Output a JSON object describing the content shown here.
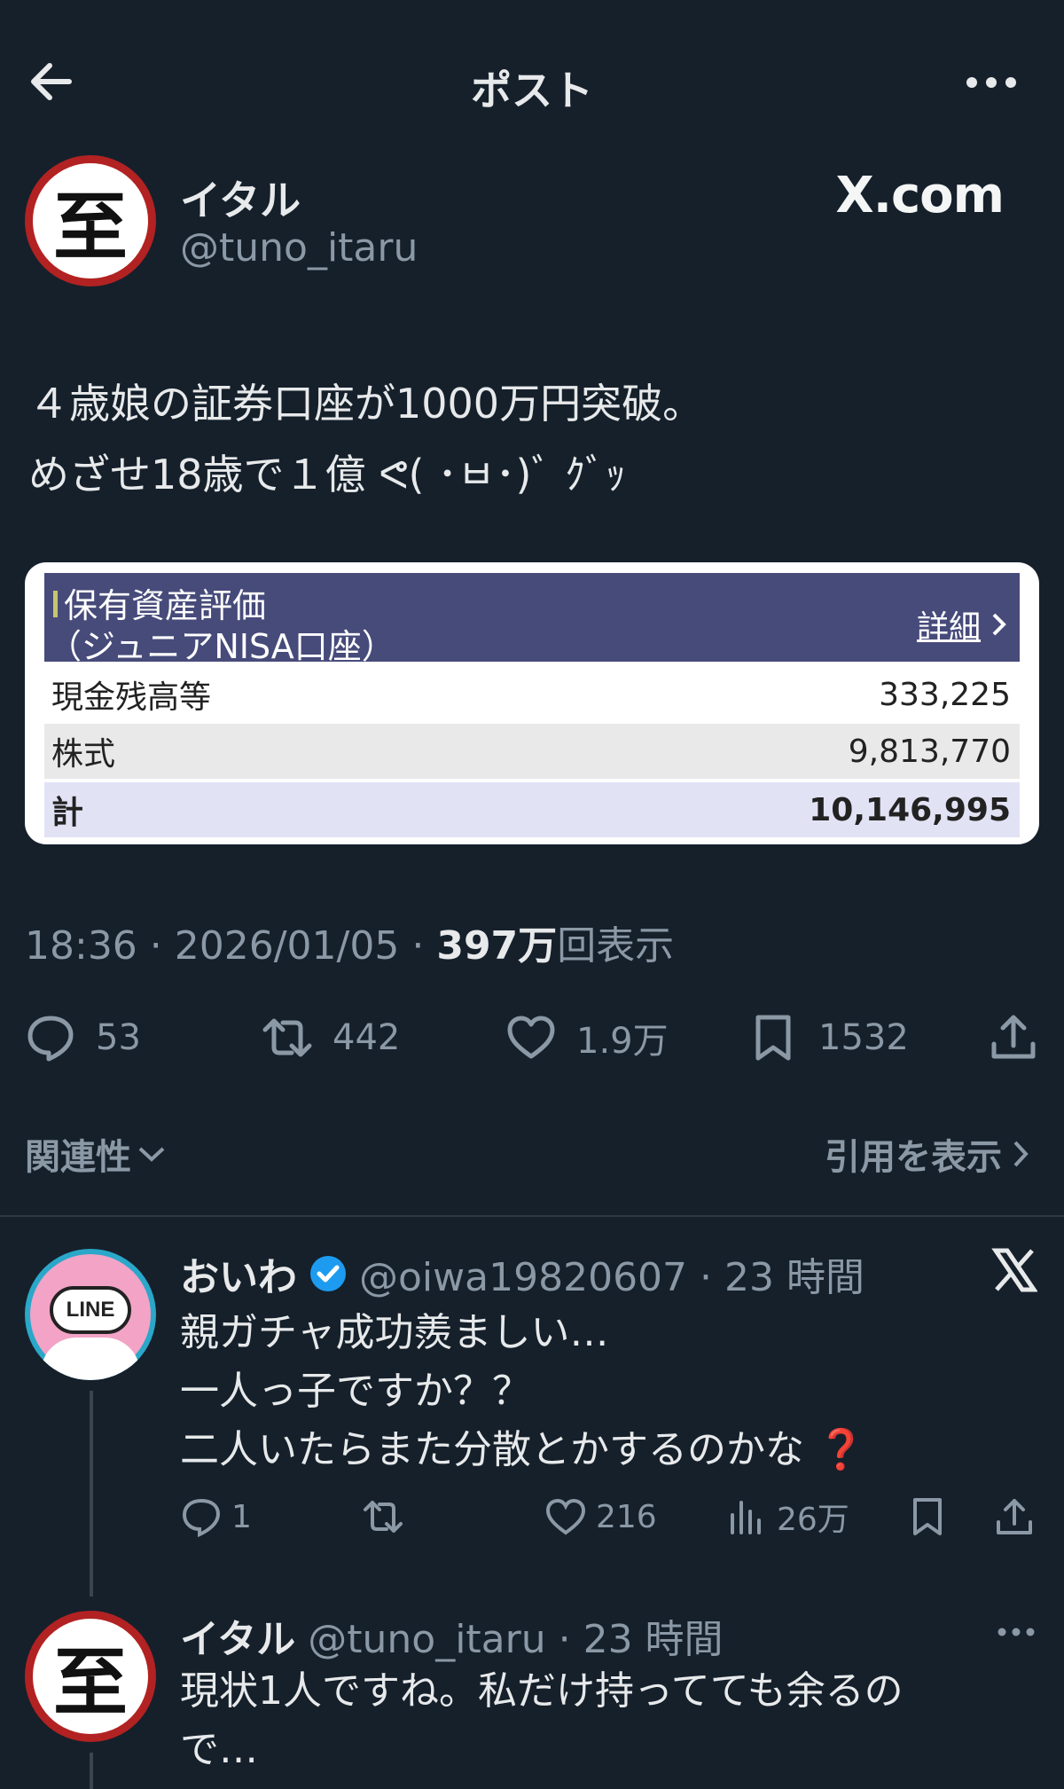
{
  "header": {
    "title": "ポスト"
  },
  "author": {
    "avatar_char": "至",
    "name": "イタル",
    "handle": "@tuno_itaru",
    "watermark": "X.com"
  },
  "tweet": {
    "line1": "４歳娘の証券口座が1000万円突破。",
    "line2": "めざせ18歳で１億 ᕙ( ･ㅂ･)ﾞ ｸﾞｯ"
  },
  "card": {
    "title1": "保有資産評価",
    "title2": "（ジュニアNISA口座）",
    "detail": "詳細",
    "rows": [
      {
        "label": "現金残高等",
        "value": "333,225"
      },
      {
        "label": "株式",
        "value": "9,813,770"
      },
      {
        "label": "計",
        "value": "10,146,995"
      }
    ]
  },
  "meta": {
    "time": "18:36 · 2026/01/05 · ",
    "views": "397万",
    "views_suffix": "回表示"
  },
  "actions": {
    "replies": "53",
    "retweets": "442",
    "likes": "1.9万",
    "bookmarks": "1532"
  },
  "filters": {
    "relevance": "関連性",
    "quotes": "引用を表示"
  },
  "reply1": {
    "name": "おいわ",
    "meta": "@oiwa19820607 · 23 時間",
    "avatar_text": "LINE",
    "lines": [
      "親ガチャ成功羨ましい…",
      "一人っ子ですか？？",
      "二人いたらまた分散とかするのかな ❓"
    ],
    "replies": "1",
    "likes": "216",
    "views": "26万"
  },
  "reply2": {
    "name": "イタル",
    "meta": "@tuno_itaru · 23 時間",
    "lines": [
      "現状1人ですね。私だけ持ってても余るの",
      "で…"
    ]
  },
  "colors": {
    "background": "#15202b",
    "text": "#e7e9ea",
    "secondary": "#8b98a5",
    "verified": "#1d9bf0",
    "card_header": "#474b7a"
  }
}
